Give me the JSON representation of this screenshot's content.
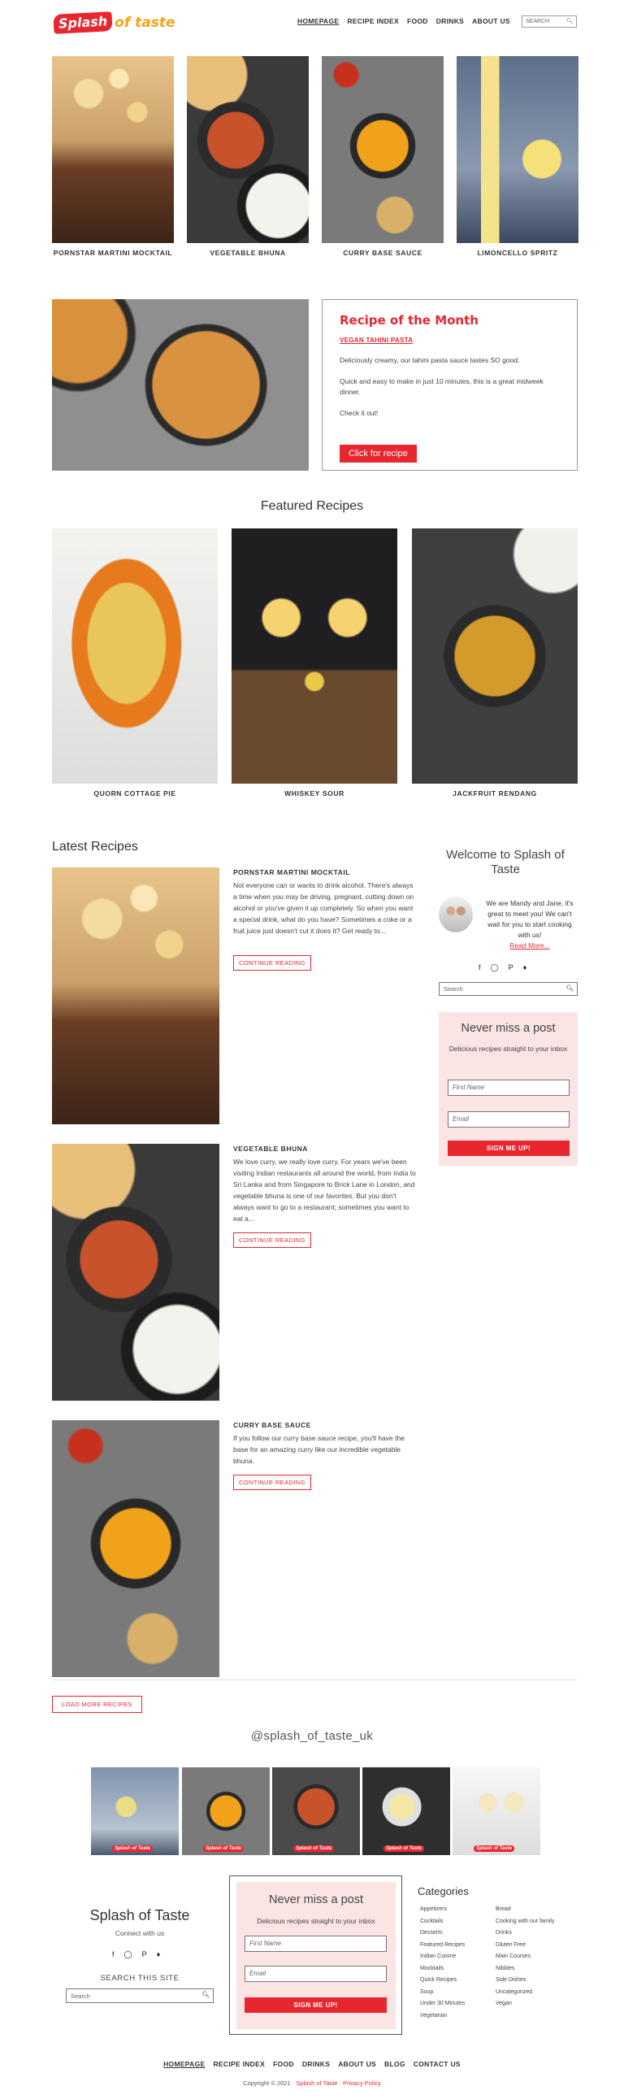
{
  "header": {
    "logo_splash": "Splash",
    "logo_rest": "of taste",
    "nav": [
      "HOMEPAGE",
      "RECIPE INDEX",
      "FOOD",
      "DRINKS",
      "ABOUT US"
    ],
    "search_placeholder": "SEARCH"
  },
  "top_recipes": [
    {
      "title": "PORNSTAR MARTINI MOCKTAIL",
      "image": "martini-mocktail-photo"
    },
    {
      "title": "VEGETABLE BHUNA",
      "image": "vegetable-bhuna-photo"
    },
    {
      "title": "CURRY BASE SAUCE",
      "image": "curry-base-sauce-photo"
    },
    {
      "title": "LIMONCELLO SPRITZ",
      "image": "limoncello-spritz-photo"
    }
  ],
  "recipe_of_month": {
    "heading": "Recipe of the Month",
    "recipe_link": "VEGAN TAHINI PASTA",
    "para1": "Deliciously creamy, our tahini pasta sauce tastes SO good.",
    "para2": "Quick and easy to make in just 10 minutes, this is a great midweek dinner.",
    "para3": "Check it out!",
    "button": "Click for recipe"
  },
  "featured": {
    "heading": "Featured Recipes",
    "items": [
      {
        "title": "QUORN COTTAGE PIE"
      },
      {
        "title": "WHISKEY SOUR"
      },
      {
        "title": "JACKFRUIT RENDANG"
      }
    ]
  },
  "latest": {
    "heading": "Latest Recipes",
    "posts": [
      {
        "title": "PORNSTAR MARTINI MOCKTAIL",
        "excerpt": "Not everyone can or wants to drink alcohol. There's always a time when you may be driving, pregnant, cutting down on alcohol or you've given it up completely. So when you want a special drink, what do you have? Sometimes a coke or a fruit juice just doesn't cut it does it? Get ready to...",
        "button": "CONTINUE READING"
      },
      {
        "title": "VEGETABLE BHUNA",
        "excerpt": "We love curry, we really love curry. For years we've been visiting Indian restaurants all around the world, from India to Sri Lanka and from Singapore to Brick Lane in London, and vegetable bhuna is one of our favorites. But you don't always want to go to a restaurant; sometimes you want to eat a...",
        "button": "CONTINUE READING"
      },
      {
        "title": "CURRY BASE SAUCE",
        "excerpt": "If you follow our curry base sauce recipe, you'll have the base for an amazing curry like our incredible vegetable bhuna.",
        "button": "CONTINUE READING"
      }
    ],
    "load_more": "LOAD MORE RECIPES"
  },
  "sidebar": {
    "welcome_title": "Welcome to Splash of Taste",
    "welcome_text": "We are Mandy and Jane, it's great to meet you! We can't wait for you to start cooking with us!",
    "read_more": "Read More...",
    "search_placeholder": "Search",
    "signup": {
      "title": "Never miss a post",
      "subtitle": "Delicious recipes straight to your inbox",
      "first_name": "First Name",
      "email": "Email",
      "button": "SIGN ME UP!"
    }
  },
  "social_icons": [
    "facebook-icon",
    "instagram-icon",
    "pinterest-icon",
    "twitter-icon"
  ],
  "instagram": {
    "handle": "@splash_of_taste_uk",
    "thumb_label": "Splash of Taste"
  },
  "footer": {
    "site_name": "Splash of Taste",
    "connect": "Connect with us",
    "search_label": "SEARCH THIS SITE",
    "search_placeholder": "Search",
    "signup": {
      "title": "Never miss a post",
      "subtitle": "Delicious recipes straight to your inbox",
      "first_name": "First Name",
      "email": "Email",
      "button": "SIGN ME UP!"
    },
    "categories_title": "Categories",
    "categories_col1": [
      "Appetizers",
      "Cocktails",
      "Desserts",
      "Featured Recipes",
      "Indian Cuisine",
      "Mocktails",
      "Quick Recipes",
      "Soup",
      "Under 30 Minutes",
      "Vegetarian"
    ],
    "categories_col2": [
      "Bread",
      "Cooking with our family",
      "Drinks",
      "Gluten Free",
      "Main Courses",
      "Nibbles",
      "Side Dishes",
      "Uncategorized",
      "Vegan"
    ],
    "nav": [
      "HOMEPAGE",
      "RECIPE INDEX",
      "FOOD",
      "DRINKS",
      "ABOUT US",
      "BLOG",
      "CONTACT US"
    ],
    "copyright_prefix": "Copyright © 2021 ·",
    "copyright_link": "Splash of Taste · Privacy Policy"
  },
  "colors": {
    "accent": "#e8262f",
    "logo_orange": "#f5a319",
    "signup_bg": "#fbe4e4"
  }
}
